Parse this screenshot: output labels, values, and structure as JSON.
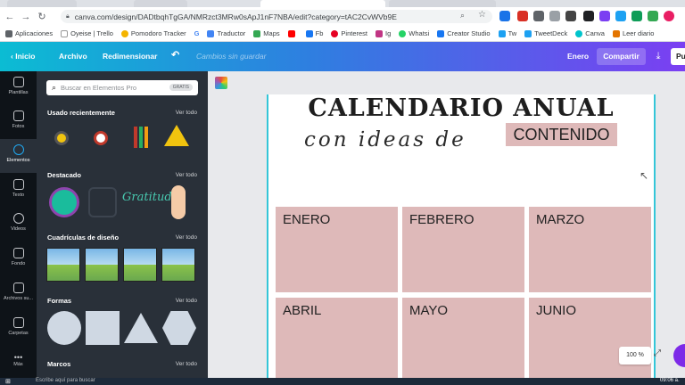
{
  "browser": {
    "url": "canva.com/design/DADtbqhTgGA/NMRzct3MRw0sApJ1nF7NBA/edit?category=tAC2CvWVb9E",
    "bookmarks": [
      "Aplicaciones",
      "Oyeise | Trello",
      "Pomodoro Tracker",
      "Traductor",
      "Maps",
      "Fb",
      "Pinterest",
      "Ig",
      "Whatsi",
      "Creator Studio",
      "Tw",
      "TweetDeck",
      "Canva",
      "Leer diario"
    ]
  },
  "toolbar": {
    "home": "Inicio",
    "file": "Archivo",
    "resize": "Redimensionar",
    "undo_icon": "undo-icon",
    "status": "Cambios sin guardar",
    "month_label": "Enero",
    "share": "Compartir",
    "publish": "Pu"
  },
  "rail": [
    {
      "label": "Plantillas",
      "icon": "template-icon"
    },
    {
      "label": "Fotos",
      "icon": "photo-icon"
    },
    {
      "label": "Elementos",
      "icon": "elements-icon"
    },
    {
      "label": "Texto",
      "icon": "text-icon"
    },
    {
      "label": "Videos",
      "icon": "video-icon"
    },
    {
      "label": "Fondo",
      "icon": "background-icon"
    },
    {
      "label": "Archivos su...",
      "icon": "upload-icon"
    },
    {
      "label": "Carpetas",
      "icon": "folder-icon"
    },
    {
      "label": "Más",
      "icon": "more-icon"
    }
  ],
  "panel": {
    "search_placeholder": "Buscar en Elementos Pro",
    "search_badge": "GRATIS",
    "see_all": "Ver todo",
    "sections": [
      "Usado recientemente",
      "Destacado",
      "Cuadrículas de diseño",
      "Formas",
      "Marcos"
    ],
    "featured_text": "Gratitud"
  },
  "design": {
    "title": "CALENDARIO ANUAL",
    "subtitle": "con ideas de",
    "highlight": "CONTENIDO",
    "months": [
      "ENERO",
      "FEBRERO",
      "MARZO",
      "ABRIL",
      "MAYO",
      "JUNIO"
    ],
    "month_color": "#deb9b9"
  },
  "zoom": "100 %",
  "taskbar": {
    "search": "Escribe aquí para buscar",
    "time": "09:06 a."
  }
}
